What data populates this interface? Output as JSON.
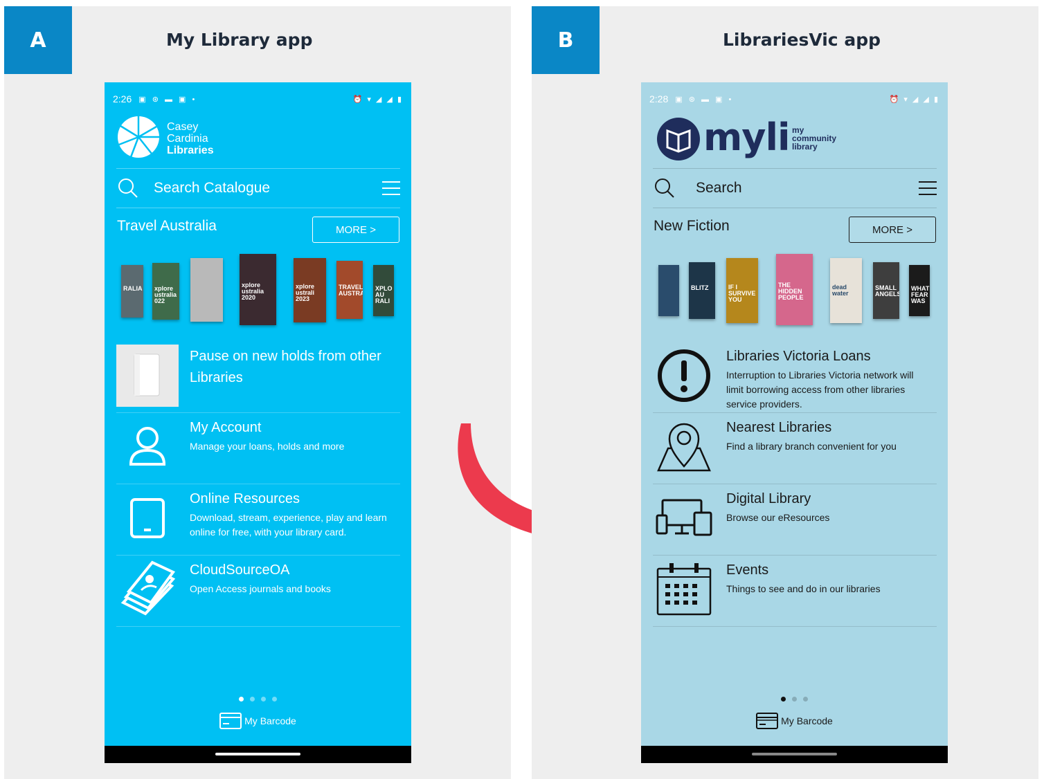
{
  "panel_a": {
    "tag": "A",
    "title": "My Library app",
    "phone": {
      "status_time": "2:26",
      "logo_lines": [
        "Casey",
        "Cardinia",
        "Libraries"
      ],
      "search_placeholder": "Search Catalogue",
      "section_title": "Travel Australia",
      "more_label": "MORE >",
      "covers": [
        {
          "label": "RALIA",
          "color": "#5b6a70"
        },
        {
          "label": "xplore ustralia 022",
          "color": "#3f6b4a"
        },
        {
          "label": "",
          "color": "#b9b9b9"
        },
        {
          "label": "xplore ustralia 2020",
          "color": "#3b2a30"
        },
        {
          "label": "xplore ustrali 2023",
          "color": "#7a3b23"
        },
        {
          "label": "TRAVEL AUSTRALIA",
          "color": "#a24a2b"
        },
        {
          "label": "XPLO AU RALI",
          "color": "#324b3a"
        }
      ],
      "items": [
        {
          "title": "Pause on new holds from other Libraries",
          "desc": "",
          "icon": "book-cover-icon"
        },
        {
          "title": "My Account",
          "desc": "Manage your loans, holds and more",
          "icon": "user-icon"
        },
        {
          "title": "Online Resources",
          "desc": "Download, stream, experience, play and learn online for free, with your library card.",
          "icon": "tablet-icon"
        },
        {
          "title": "CloudSourceOA",
          "desc": "Open Access journals and books",
          "icon": "papers-icon"
        }
      ],
      "barcode_label": "My Barcode"
    }
  },
  "panel_b": {
    "tag": "B",
    "title": "LibrariesVic app",
    "phone": {
      "status_time": "2:28",
      "logo_text": "myli",
      "logo_tag": [
        "my",
        "community",
        "library"
      ],
      "search_placeholder": "Search",
      "section_title": "New Fiction",
      "more_label": "MORE >",
      "covers": [
        {
          "label": "",
          "color": "#2a4c6c"
        },
        {
          "label": "BLITZ",
          "color": "#1d3548"
        },
        {
          "label": "IF I SURVIVE YOU",
          "color": "#b5871c"
        },
        {
          "label": "THE HIDDEN PEOPLE",
          "color": "#d5678c"
        },
        {
          "label": "dead water",
          "color": "#e7e2d9"
        },
        {
          "label": "SMALL ANGELS",
          "color": "#3e3e3e"
        },
        {
          "label": "WHAT FEAR WAS",
          "color": "#1b1b1b"
        }
      ],
      "items": [
        {
          "title": "Libraries Victoria Loans",
          "desc": "Interruption to Libraries Victoria network will limit borrowing access from other libraries service providers.",
          "icon": "alert-icon"
        },
        {
          "title": "Nearest Libraries",
          "desc": "Find a library branch convenient for you",
          "icon": "map-pin-icon"
        },
        {
          "title": "Digital Library",
          "desc": "Browse our eResources",
          "icon": "devices-icon"
        },
        {
          "title": "Events",
          "desc": "Things to see and do in our libraries",
          "icon": "calendar-icon"
        }
      ],
      "barcode_label": "My Barcode"
    }
  },
  "colors": {
    "tag_blue": "#0a87c6",
    "phone_a_bg": "#00c0f3",
    "phone_b_bg": "#a9d7e6",
    "arrow_red": "#ec3a4d"
  }
}
